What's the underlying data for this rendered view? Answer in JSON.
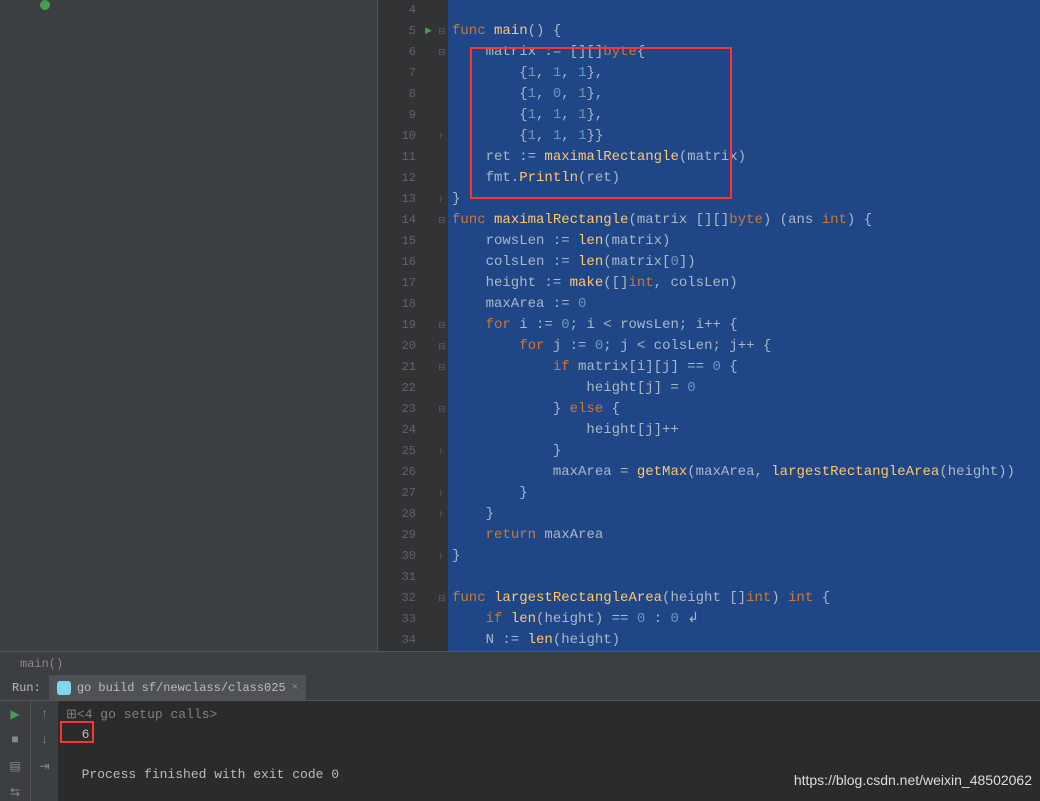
{
  "gutter": {
    "start": 4,
    "end": 34,
    "run_marker_line": 5
  },
  "code": [
    {
      "n": 4,
      "fold": "",
      "html": ""
    },
    {
      "n": 5,
      "fold": "⊟",
      "html": "<span class='kw'>func</span> <span class='fn'>main</span>() {"
    },
    {
      "n": 6,
      "fold": "⊟",
      "html": "    matrix := [][]<span class='kw'>byte</span>{"
    },
    {
      "n": 7,
      "fold": "",
      "html": "        {<span class='num'>1</span>, <span class='num'>1</span>, <span class='num'>1</span>},"
    },
    {
      "n": 8,
      "fold": "",
      "html": "        {<span class='num'>1</span>, <span class='num'>0</span>, <span class='num'>1</span>},"
    },
    {
      "n": 9,
      "fold": "",
      "html": "        {<span class='num'>1</span>, <span class='num'>1</span>, <span class='num'>1</span>},"
    },
    {
      "n": 10,
      "fold": "⊦",
      "html": "        {<span class='num'>1</span>, <span class='num'>1</span>, <span class='num'>1</span>}}"
    },
    {
      "n": 11,
      "fold": "",
      "html": "    ret := <span class='fn'>maximalRectangle</span>(matrix)"
    },
    {
      "n": 12,
      "fold": "",
      "html": "    fmt.<span class='fn'>Println</span>(ret)"
    },
    {
      "n": 13,
      "fold": "⊦",
      "html": "}"
    },
    {
      "n": 14,
      "fold": "⊟",
      "html": "<span class='kw'>func</span> <span class='fn'>maximalRectangle</span>(matrix [][]<span class='kw'>byte</span>) (ans <span class='kw'>int</span>) {"
    },
    {
      "n": 15,
      "fold": "",
      "html": "    rowsLen := <span class='fn'>len</span>(matrix)"
    },
    {
      "n": 16,
      "fold": "",
      "html": "    colsLen := <span class='fn'>len</span>(matrix[<span class='num'>0</span>])"
    },
    {
      "n": 17,
      "fold": "",
      "html": "    height := <span class='fn'>make</span>([]<span class='kw'>int</span>, colsLen)"
    },
    {
      "n": 18,
      "fold": "",
      "html": "    maxArea := <span class='num'>0</span>"
    },
    {
      "n": 19,
      "fold": "⊟",
      "html": "    <span class='kw'>for</span> i := <span class='num'>0</span>; i &lt; rowsLen; i++ {"
    },
    {
      "n": 20,
      "fold": "⊟",
      "html": "        <span class='kw'>for</span> j := <span class='num'>0</span>; j &lt; colsLen; j++ {"
    },
    {
      "n": 21,
      "fold": "⊟",
      "html": "            <span class='kw'>if</span> matrix[i][j] == <span class='num'>0</span> {"
    },
    {
      "n": 22,
      "fold": "",
      "html": "                height[j] = <span class='num'>0</span>"
    },
    {
      "n": 23,
      "fold": "⊟",
      "html": "            } <span class='kw'>else</span> {"
    },
    {
      "n": 24,
      "fold": "",
      "html": "                height[j]++"
    },
    {
      "n": 25,
      "fold": "⊦",
      "html": "            }"
    },
    {
      "n": 26,
      "fold": "",
      "html": "            maxArea = <span class='fn'>getMax</span>(maxArea, <span class='fn'>largestRectangleArea</span>(height))"
    },
    {
      "n": 27,
      "fold": "⊦",
      "html": "        }"
    },
    {
      "n": 28,
      "fold": "⊦",
      "html": "    }"
    },
    {
      "n": 29,
      "fold": "",
      "html": "    <span class='kw'>return</span> maxArea"
    },
    {
      "n": 30,
      "fold": "⊦",
      "html": "}"
    },
    {
      "n": 31,
      "fold": "",
      "html": ""
    },
    {
      "n": 32,
      "fold": "⊟",
      "html": "<span class='kw'>func</span> <span class='fn'>largestRectangleArea</span>(height []<span class='kw'>int</span>) <span class='kw'>int</span> {"
    },
    {
      "n": 33,
      "fold": "",
      "html": "    <span class='kw'>if</span> <span class='fn'>len</span>(height) == <span class='num'>0</span> : <span class='num'>0</span> ↲"
    },
    {
      "n": 34,
      "fold": "",
      "html": "    N := <span class='fn'>len</span>(height)"
    }
  ],
  "breadcrumb": "main()",
  "run": {
    "label": "Run:",
    "tab": "go build sf/newclass/class025",
    "console_lines": [
      "⊞<4 go setup calls>",
      "  6",
      "",
      "  Process finished with exit code 0"
    ]
  },
  "watermark": "https://blog.csdn.net/weixin_48502062"
}
